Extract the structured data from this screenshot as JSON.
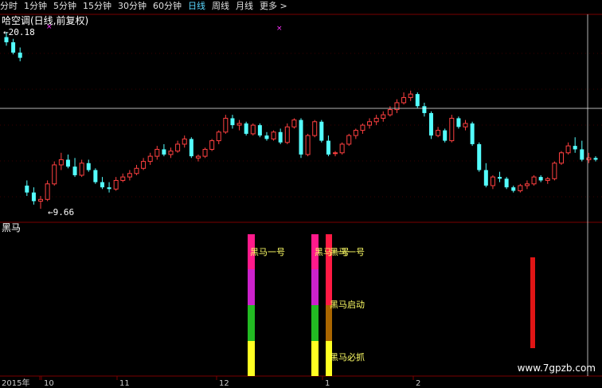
{
  "toolbar": {
    "tabs": [
      "分时",
      "1分钟",
      "5分钟",
      "15分钟",
      "30分钟",
      "60分钟",
      "日线",
      "周线",
      "月线",
      "更多 >"
    ],
    "active": "日线"
  },
  "main_chart": {
    "title": "哈空调(日线,前复权)",
    "high_marker": "20.18",
    "low_marker": "9.66",
    "crosshair_price_note": ""
  },
  "indicator": {
    "name": "黑马",
    "signals": [
      {
        "label": "黑马一号",
        "color": "#ffff66"
      },
      {
        "label": "黑马一号",
        "color": "#ffff66"
      },
      {
        "label": "黑马一号",
        "color": "#ffff66"
      },
      {
        "label": "黑马启动",
        "color": "#ffff66"
      },
      {
        "label": "黑马必抓",
        "color": "#ffff66"
      }
    ]
  },
  "xaxis": {
    "labels": [
      "2015年",
      "10",
      "11",
      "12",
      "1",
      "2"
    ]
  },
  "watermark": "www.7gpzb.com",
  "colors": {
    "up": "#ff4040",
    "down": "#54ffff",
    "grid": "#7a0000",
    "crosshair": "#ffffff"
  },
  "chart_data": {
    "type": "candlestick",
    "title": "哈空调(日线,前复权)",
    "price_range": [
      9.66,
      20.18
    ],
    "candles": [
      [
        19.6,
        19.9,
        19.1,
        19.3
      ],
      [
        19.3,
        19.5,
        18.6,
        18.7
      ],
      [
        18.7,
        19.0,
        18.2,
        18.4
      ],
      [
        11.0,
        11.3,
        10.4,
        10.6
      ],
      [
        10.6,
        10.9,
        9.9,
        10.1
      ],
      [
        10.1,
        10.4,
        9.66,
        10.2
      ],
      [
        10.2,
        11.3,
        10.1,
        11.1
      ],
      [
        11.1,
        12.4,
        11.0,
        12.2
      ],
      [
        12.2,
        12.9,
        11.9,
        12.5
      ],
      [
        12.5,
        12.8,
        12.0,
        12.1
      ],
      [
        12.1,
        12.6,
        11.5,
        11.6
      ],
      [
        11.6,
        12.5,
        11.5,
        12.3
      ],
      [
        12.3,
        12.5,
        11.8,
        11.9
      ],
      [
        11.9,
        12.0,
        11.1,
        11.2
      ],
      [
        11.2,
        11.5,
        10.8,
        10.9
      ],
      [
        10.9,
        11.2,
        10.6,
        10.8
      ],
      [
        10.8,
        11.5,
        10.7,
        11.3
      ],
      [
        11.3,
        11.7,
        11.2,
        11.5
      ],
      [
        11.5,
        11.9,
        11.3,
        11.7
      ],
      [
        11.7,
        12.2,
        11.6,
        12.0
      ],
      [
        12.0,
        12.6,
        11.9,
        12.4
      ],
      [
        12.4,
        12.9,
        12.2,
        12.7
      ],
      [
        12.7,
        13.3,
        12.5,
        13.1
      ],
      [
        13.1,
        13.4,
        12.7,
        12.8
      ],
      [
        12.8,
        13.2,
        12.6,
        13.0
      ],
      [
        13.0,
        13.6,
        12.9,
        13.4
      ],
      [
        13.4,
        13.9,
        13.2,
        13.7
      ],
      [
        13.7,
        13.8,
        12.6,
        12.7
      ],
      [
        12.6,
        12.8,
        12.4,
        12.7
      ],
      [
        12.7,
        13.2,
        12.6,
        13.1
      ],
      [
        13.1,
        13.7,
        13.0,
        13.6
      ],
      [
        13.6,
        14.2,
        13.4,
        14.1
      ],
      [
        14.1,
        15.1,
        14.0,
        14.9
      ],
      [
        14.9,
        15.1,
        14.3,
        14.5
      ],
      [
        14.5,
        14.8,
        14.2,
        14.6
      ],
      [
        14.6,
        14.7,
        13.9,
        14.0
      ],
      [
        14.0,
        14.6,
        13.9,
        14.5
      ],
      [
        14.5,
        14.6,
        13.8,
        13.9
      ],
      [
        13.9,
        14.1,
        13.6,
        13.7
      ],
      [
        13.7,
        14.2,
        13.6,
        14.1
      ],
      [
        14.1,
        14.3,
        13.4,
        13.5
      ],
      [
        13.5,
        14.6,
        13.4,
        14.4
      ],
      [
        14.4,
        14.9,
        14.3,
        14.8
      ],
      [
        14.8,
        14.9,
        12.6,
        12.8
      ],
      [
        12.8,
        14.0,
        12.7,
        13.9
      ],
      [
        13.9,
        14.8,
        13.8,
        14.7
      ],
      [
        14.7,
        14.8,
        13.5,
        13.6
      ],
      [
        13.6,
        13.9,
        12.7,
        12.8
      ],
      [
        12.9,
        13.0,
        12.7,
        12.9
      ],
      [
        12.9,
        13.5,
        12.8,
        13.4
      ],
      [
        13.4,
        14.0,
        13.3,
        13.9
      ],
      [
        13.9,
        14.3,
        13.7,
        14.2
      ],
      [
        14.2,
        14.6,
        14.0,
        14.5
      ],
      [
        14.5,
        14.9,
        14.3,
        14.7
      ],
      [
        14.7,
        15.1,
        14.5,
        14.9
      ],
      [
        14.9,
        15.3,
        14.7,
        15.1
      ],
      [
        15.1,
        15.6,
        15.0,
        15.4
      ],
      [
        15.4,
        16.0,
        15.2,
        15.8
      ],
      [
        15.8,
        16.4,
        15.7,
        16.1
      ],
      [
        16.1,
        16.5,
        15.9,
        16.3
      ],
      [
        16.3,
        16.4,
        15.5,
        15.6
      ],
      [
        15.6,
        15.8,
        15.0,
        15.2
      ],
      [
        15.2,
        15.3,
        13.7,
        13.9
      ],
      [
        13.9,
        14.4,
        13.8,
        14.2
      ],
      [
        14.2,
        14.3,
        13.5,
        13.6
      ],
      [
        13.6,
        15.1,
        13.5,
        14.9
      ],
      [
        14.9,
        15.0,
        14.3,
        14.4
      ],
      [
        14.4,
        14.8,
        14.2,
        14.6
      ],
      [
        14.6,
        14.7,
        13.3,
        13.4
      ],
      [
        13.4,
        13.5,
        11.8,
        11.9
      ],
      [
        11.9,
        12.3,
        10.9,
        11.0
      ],
      [
        11.0,
        11.6,
        10.8,
        11.5
      ],
      [
        11.5,
        11.8,
        11.2,
        11.4
      ],
      [
        11.4,
        11.5,
        10.8,
        10.9
      ],
      [
        10.9,
        11.0,
        10.6,
        10.7
      ],
      [
        10.7,
        11.1,
        10.6,
        11.0
      ],
      [
        11.0,
        11.3,
        10.8,
        11.1
      ],
      [
        11.1,
        11.6,
        11.0,
        11.5
      ],
      [
        11.5,
        11.6,
        11.2,
        11.3
      ],
      [
        11.3,
        11.5,
        11.1,
        11.4
      ],
      [
        11.4,
        12.4,
        11.3,
        12.3
      ],
      [
        12.3,
        13.0,
        12.2,
        12.9
      ],
      [
        12.9,
        13.5,
        12.8,
        13.3
      ],
      [
        13.3,
        13.8,
        12.9,
        13.1
      ],
      [
        13.1,
        13.6,
        12.4,
        12.5
      ],
      [
        12.5,
        12.9,
        12.3,
        12.6
      ],
      [
        12.6,
        12.7,
        12.4,
        12.5
      ]
    ]
  }
}
